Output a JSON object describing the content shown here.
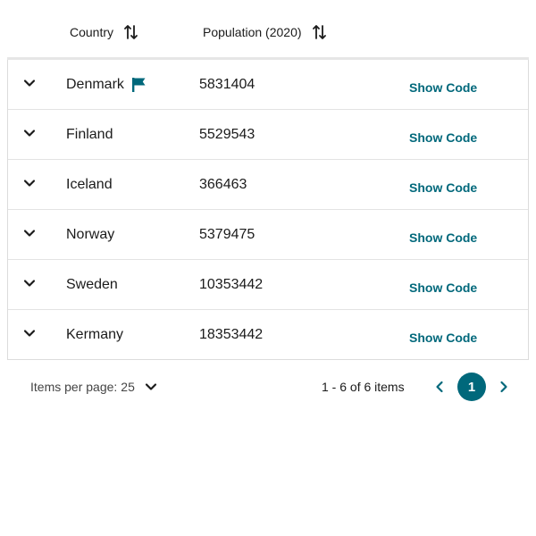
{
  "header": {
    "country_label": "Country",
    "population_label": "Population (2020)"
  },
  "rows": [
    {
      "country": "Denmark",
      "population": "5831404",
      "action": "Show Code",
      "flagged": true
    },
    {
      "country": "Finland",
      "population": "5529543",
      "action": "Show Code",
      "flagged": false
    },
    {
      "country": "Iceland",
      "population": "366463",
      "action": "Show Code",
      "flagged": false
    },
    {
      "country": "Norway",
      "population": "5379475",
      "action": "Show Code",
      "flagged": false
    },
    {
      "country": "Sweden",
      "population": "10353442",
      "action": "Show Code",
      "flagged": false
    },
    {
      "country": "Kermany",
      "population": "18353442",
      "action": "Show Code",
      "flagged": false
    }
  ],
  "footer": {
    "items_per_page_label": "Items per page:",
    "items_per_page_value": "25",
    "range_text": "1 - 6 of 6 items",
    "current_page": "1"
  },
  "colors": {
    "accent": "#00687b",
    "text": "#1b1b1b",
    "border": "#dcdcdc"
  },
  "icons": {
    "sort": "sort-arrows-icon",
    "expand": "chevron-down-icon",
    "flag": "flag-icon",
    "prev": "chevron-left-icon",
    "next": "chevron-right-icon"
  }
}
